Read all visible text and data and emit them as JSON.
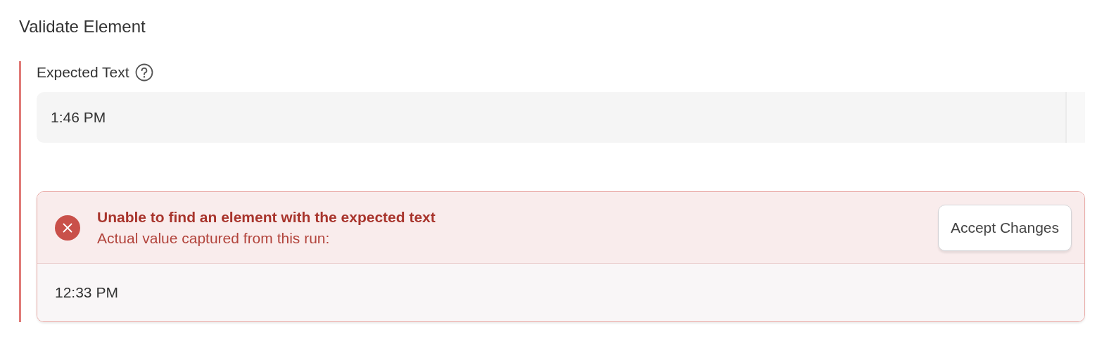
{
  "title": "Validate Element",
  "field": {
    "label": "Expected Text",
    "value": "1:46 PM",
    "invalid": true
  },
  "error": {
    "title": "Unable to find an element with the expected text",
    "message": "Actual value captured from this run:",
    "button": "Accept Changes",
    "actual_value": "12:33 PM"
  }
}
